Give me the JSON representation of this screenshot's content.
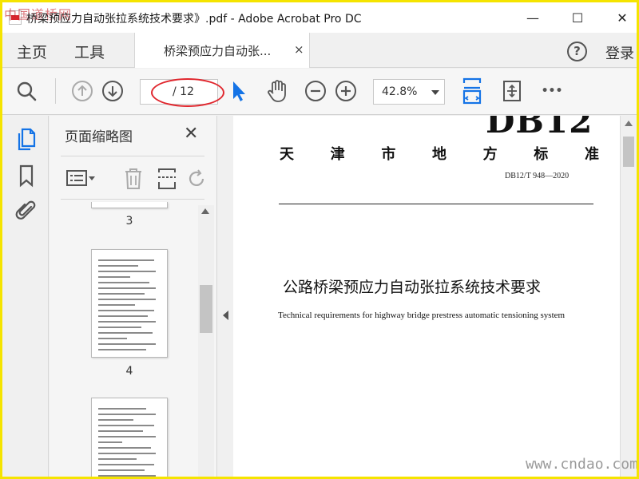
{
  "window": {
    "title": "桥梁预应力自动张拉系统技术要求》.pdf - Adobe Acrobat Pro DC",
    "minimize_glyph": "—",
    "maximize_glyph": "☐",
    "close_glyph": "✕",
    "watermark_top": "中国道桥网"
  },
  "tabs": {
    "home": "主页",
    "tools": "工具",
    "document": "桥梁预应力自动张...",
    "close_glyph": "×",
    "help_glyph": "?",
    "login": "登录"
  },
  "toolbar": {
    "page_current": "",
    "page_total": "/ 12",
    "zoom": "42.8%",
    "more_glyph": "•••"
  },
  "thumbnail_panel": {
    "title": "页面缩略图",
    "close_glyph": "✕",
    "pages": [
      {
        "number": "3"
      },
      {
        "number": "4"
      }
    ]
  },
  "document": {
    "code_large": "DB12",
    "standard_chars": [
      "天",
      "津",
      "市",
      "地",
      "方",
      "标",
      "准"
    ],
    "code": "DB12/T 948—2020",
    "title_cn": "公路桥梁预应力自动张拉系统技术要求",
    "title_en": "Technical requirements for highway bridge prestress automatic tensioning system"
  },
  "watermark_bottom": "www.cndao.com",
  "colors": {
    "frame": "#f5e400",
    "accent_blue": "#1473e6",
    "annotation_red": "#e0262d"
  }
}
